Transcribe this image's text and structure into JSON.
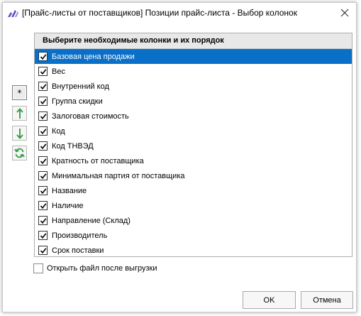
{
  "window": {
    "title": "[Прайс-листы от поставщиков] Позиции прайс-листа - Выбор колонок"
  },
  "colors": {
    "accent": "#0a6fc7",
    "icon_purple": "#6a4bc8",
    "icon_green": "#2e9a3a"
  },
  "list": {
    "header": "Выберите необходимые колонки и их порядок",
    "items": [
      {
        "label": "Базовая цена продажи",
        "checked": true,
        "selected": true
      },
      {
        "label": "Вес",
        "checked": true,
        "selected": false
      },
      {
        "label": "Внутренний код",
        "checked": true,
        "selected": false
      },
      {
        "label": "Группа скидки",
        "checked": true,
        "selected": false
      },
      {
        "label": "Залоговая стоимость",
        "checked": true,
        "selected": false
      },
      {
        "label": "Код",
        "checked": true,
        "selected": false
      },
      {
        "label": "Код ТНВЭД",
        "checked": true,
        "selected": false
      },
      {
        "label": "Кратность от поставщика",
        "checked": true,
        "selected": false
      },
      {
        "label": "Минимальная партия от поставщика",
        "checked": true,
        "selected": false
      },
      {
        "label": "Название",
        "checked": true,
        "selected": false
      },
      {
        "label": "Наличие",
        "checked": true,
        "selected": false
      },
      {
        "label": "Направление (Склад)",
        "checked": true,
        "selected": false
      },
      {
        "label": "Производитель",
        "checked": true,
        "selected": false
      },
      {
        "label": "Срок поставки",
        "checked": true,
        "selected": false
      }
    ]
  },
  "side_buttons": {
    "select_all_label": "*"
  },
  "open_file": {
    "label": "Открыть файл после выгрузки",
    "checked": false
  },
  "buttons": {
    "ok": "OK",
    "cancel": "Отмена"
  }
}
